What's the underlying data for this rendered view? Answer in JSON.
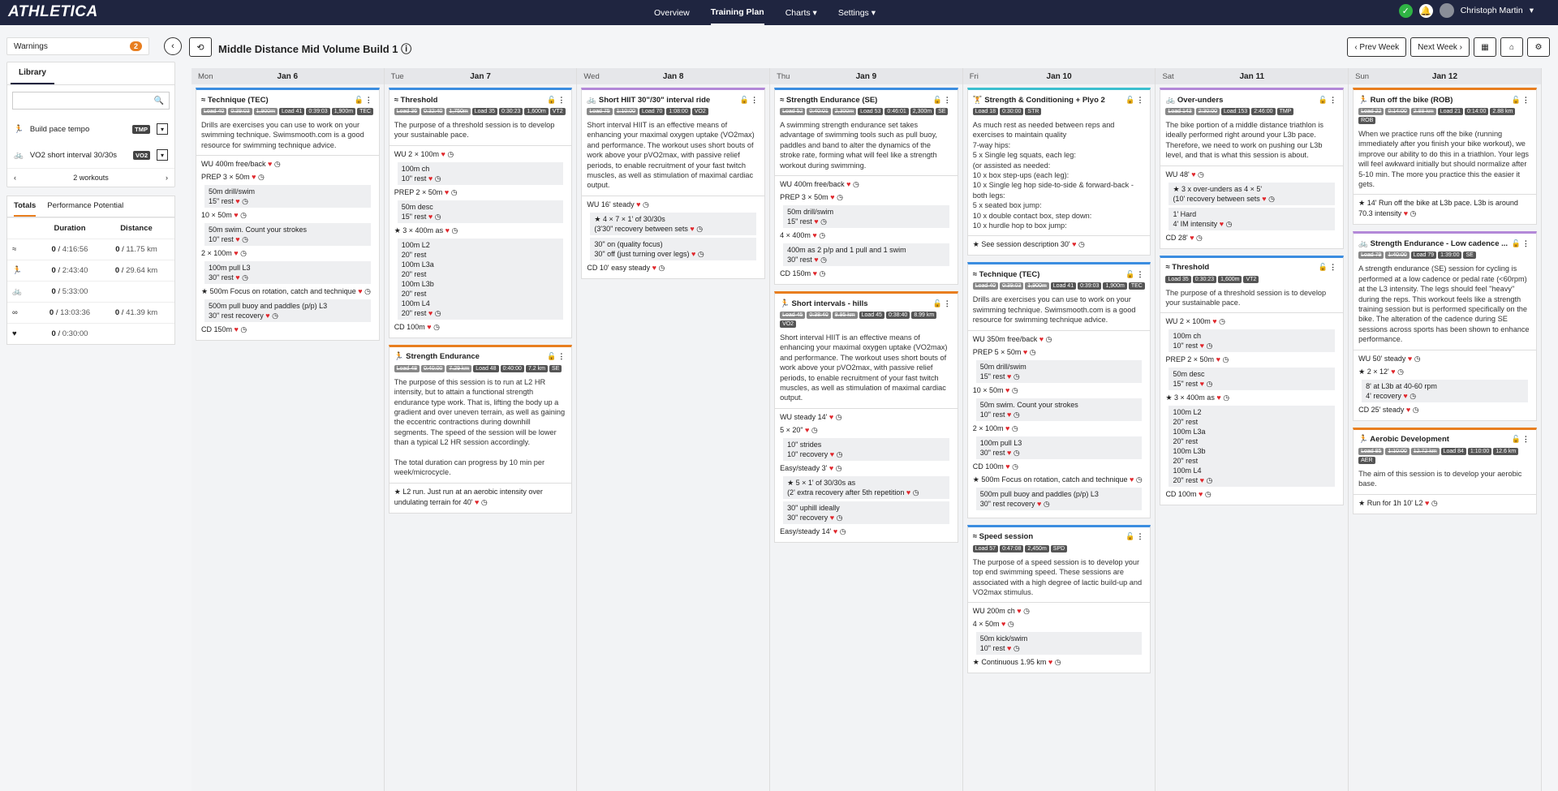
{
  "brand": "ATHLETICA",
  "nav": [
    "Overview",
    "Training Plan",
    "Charts",
    "Settings"
  ],
  "user": "Christoph Martin",
  "notif_count": "0",
  "warnings": {
    "label": "Warnings",
    "count": "2"
  },
  "library": {
    "tab": "Library",
    "items": [
      {
        "name": "Build pace tempo",
        "tag": "TMP"
      },
      {
        "name": "VO2 short interval 30/30s",
        "tag": "VO2"
      }
    ],
    "pager": "2 workouts"
  },
  "totals": {
    "tabs": [
      "Totals",
      "Performance Potential"
    ],
    "headers": [
      "Duration",
      "Distance"
    ],
    "rows": [
      {
        "d1": "0",
        "d2": "4:16:56",
        "k1": "0",
        "k2": "11.75 km"
      },
      {
        "d1": "0",
        "d2": "2:43:40",
        "k1": "0",
        "k2": "29.64 km"
      },
      {
        "d1": "0",
        "d2": "5:33:00",
        "k1": "",
        "k2": ""
      },
      {
        "d1": "0",
        "d2": "13:03:36",
        "k1": "0",
        "k2": "41.39 km"
      },
      {
        "d1": "0",
        "d2": "0:30:00",
        "k1": "",
        "k2": ""
      }
    ]
  },
  "plan": {
    "title": "Middle Distance Mid Volume Build 1",
    "prev": "Prev Week",
    "next": "Next Week"
  },
  "days": [
    {
      "d": "Mon",
      "date": "Jan 6"
    },
    {
      "d": "Tue",
      "date": "Jan 7"
    },
    {
      "d": "Wed",
      "date": "Jan 8"
    },
    {
      "d": "Thu",
      "date": "Jan 9"
    },
    {
      "d": "Fri",
      "date": "Jan 10"
    },
    {
      "d": "Sat",
      "date": "Jan 11"
    },
    {
      "d": "Sun",
      "date": "Jan 12"
    }
  ],
  "cards": {
    "mon1": {
      "title": "Technique (TEC)",
      "desc": "Drills are exercises you can use to work on your swimming technique. Swimsmooth.com is a good resource for swimming technique advice.",
      "lines": [
        "WU 400m free/back",
        "PREP 3 × 50m",
        "50m drill/swim\n15\" rest",
        "10 × 50m",
        "50m swim. Count your strokes\n10\" rest",
        "2 × 100m",
        "100m pull L3\n30\" rest",
        "500m Focus on rotation, catch and technique",
        "500m pull buoy and paddles (p/p) L3\n30\" rest recovery",
        "CD 150m"
      ]
    },
    "tue1": {
      "title": "Threshold",
      "desc": "The purpose of a threshold session is to develop your sustainable pace.",
      "lines": [
        "WU 2 × 100m",
        "100m ch\n10\" rest",
        "PREP 2 × 50m",
        "50m desc\n15\" rest",
        "3 × 400m as",
        "100m L2\n20\" rest\n100m L3a\n20\" rest\n100m L3b\n20\" rest\n100m L4\n20\" rest",
        "CD 100m"
      ]
    },
    "tue2": {
      "title": "Strength Endurance",
      "desc": "The purpose of this session is to run at L2 HR intensity, but to attain a functional strength endurance type work. That is, lifting the body up a gradient and over uneven terrain, as well as gaining the eccentric contractions during downhill segments. The speed of the session will be lower than a typical L2 HR session accordingly.\n\nThe total duration can progress by 10 min per week/microcycle.",
      "lines": [
        "L2 run. Just run at an aerobic intensity over undulating terrain for 40'"
      ]
    },
    "wed1": {
      "title": "Short HIIT 30\"/30\" interval ride",
      "desc": "Short interval HIIT is an effective means of enhancing your maximal oxygen uptake (VO2max) and performance. The workout uses short bouts of work above your pVO2max, with passive relief periods, to enable recruitment of your fast twitch muscles, as well as stimulation of maximal cardiac output.",
      "lines": [
        "WU 16' steady",
        "4 × 7 × 1' of 30/30s\n(3'30\" recovery between sets",
        "30\" on (quality focus)\n30\" off (just turning over legs)",
        "CD 10' easy steady"
      ]
    },
    "thu1": {
      "title": "Strength Endurance (SE)",
      "desc": "A swimming strength endurance set takes advantage of swimming tools such as pull buoy, paddles and band to alter the dynamics of the stroke rate, forming what will feel like a strength workout during swimming.",
      "lines": [
        "WU 400m free/back",
        "PREP 3 × 50m",
        "50m drill/swim\n15\" rest",
        "4 × 400m",
        "400m as 2 p/p and 1 pull and 1 swim\n30\" rest",
        "CD 150m"
      ]
    },
    "thu2": {
      "title": "Short intervals - hills",
      "desc": "Short interval HIIT is an effective means of enhancing your maximal oxygen uptake (VO2max) and performance. The workout uses short bouts of work above your pVO2max, with passive relief periods, to enable recruitment of your fast twitch muscles, as well as stimulation of maximal cardiac output.",
      "lines": [
        "WU steady 14'",
        "5 × 20\"",
        "10\" strides\n10\" recovery",
        "Easy/steady 3'",
        "5 × 1' of 30/30s as\n(2' extra recovery after 5th repetition",
        "30\" uphill ideally\n30\" recovery",
        "Easy/steady 14'"
      ]
    },
    "fri1": {
      "title": "Strength & Conditioning + Plyo 2",
      "desc": "As much rest as needed between reps and exercises to maintain quality\n7-way hips:\n5 x Single leg squats, each leg:\n(or assisted as needed:\n10 x box step-ups (each leg):\n10 x Single leg hop side-to-side & forward-back - both legs:\n5 x seated box jump:\n10 x double contact box, step down:\n10 x hurdle hop to box jump:",
      "lines": [
        "See session description 30'"
      ]
    },
    "fri2": {
      "title": "Technique (TEC)",
      "desc": "Drills are exercises you can use to work on your swimming technique. Swimsmooth.com is a good resource for swimming technique advice.",
      "lines": [
        "WU 350m free/back",
        "PREP 5 × 50m",
        "50m drill/swim\n15\" rest",
        "10 × 50m",
        "50m swim. Count your strokes\n10\" rest",
        "2 × 100m",
        "100m pull L3\n30\" rest",
        "CD 100m",
        "500m Focus on rotation, catch and technique",
        "500m pull buoy and paddles (p/p) L3\n30\" rest recovery"
      ]
    },
    "fri3": {
      "title": "Speed session",
      "desc": "The purpose of a speed session is to develop your top end swimming speed. These sessions are associated with a high degree of lactic build-up and VO2max stimulus.",
      "lines": [
        "WU 200m ch",
        "4 × 50m",
        "50m kick/swim\n10\" rest",
        "Continuous 1.95 km"
      ]
    },
    "sat1": {
      "title": "Over-unders",
      "desc": "The bike portion of a middle distance triathlon is ideally performed right around your L3b pace. Therefore, we need to work on pushing our L3b level, and that is what this session is about.",
      "lines": [
        "WU 48'",
        "3 x over-unders as 4 × 5'\n(10' recovery between sets",
        "1' Hard\n4' IM intensity",
        "CD 28'"
      ]
    },
    "sat2": {
      "title": "Threshold",
      "desc": "The purpose of a threshold session is to develop your sustainable pace.",
      "lines": [
        "WU 2 × 100m",
        "100m ch\n10\" rest",
        "PREP 2 × 50m",
        "50m desc\n15\" rest",
        "3 × 400m as",
        "100m L2\n20\" rest\n100m L3a\n20\" rest\n100m L3b\n20\" rest\n100m L4\n20\" rest",
        "CD 100m"
      ]
    },
    "sun1": {
      "title": "Run off the bike (ROB)",
      "desc": "When we practice runs off the bike (running immediately after you finish your bike workout), we improve our ability to do this in a triathlon. Your legs will feel awkward initially but should normalize after 5-10 min. The more you practice this the easier it gets.",
      "lines": [
        "14' Run off the bike at L3b pace. L3b is around 70.3 intensity"
      ]
    },
    "sun2": {
      "title": "Strength Endurance - Low cadence ...",
      "desc": "A strength endurance (SE) session for cycling is performed at a low cadence or pedal rate (<60rpm) at the L3 intensity. The legs should feel \"heavy\" during the reps. This workout feels like a strength training session but is performed specifically on the bike. The alteration of the cadence during SE sessions across sports has been shown to enhance performance.",
      "lines": [
        "WU 50' steady",
        "2 × 12'",
        "8' at L3b at 40-60 rpm\n4' recovery",
        "CD 25' steady"
      ]
    },
    "sun3": {
      "title": "Aerobic Development",
      "desc": "The aim of this session is to develop your aerobic base.",
      "lines": [
        "Run for 1h 10' L2"
      ]
    }
  },
  "tags": {
    "mon1": [
      [
        "Load 40",
        1
      ],
      [
        "0:39:03",
        1
      ],
      [
        "1,900m",
        1
      ],
      [
        "Load 41",
        0
      ],
      [
        "0:39:03",
        0
      ],
      [
        "1,900m",
        0
      ],
      [
        "TEC",
        0
      ]
    ],
    "tue1": [
      [
        "Load 36",
        1
      ],
      [
        "0:32:40",
        1
      ],
      [
        "1,750m",
        1
      ],
      [
        "Load 35",
        0
      ],
      [
        "0:30:23",
        0
      ],
      [
        "1,600m",
        0
      ],
      [
        "VT2",
        0
      ]
    ],
    "tue2": [
      [
        "Load 48",
        1
      ],
      [
        "0:40:00",
        1
      ],
      [
        "7.29 km",
        1
      ],
      [
        "Load 48",
        0
      ],
      [
        "0:40:00",
        0
      ],
      [
        "7.2 km",
        0
      ],
      [
        "SE",
        0
      ]
    ],
    "wed1": [
      [
        "Load 75",
        1
      ],
      [
        "1:10:00",
        1
      ],
      [
        "Load 70",
        0
      ],
      [
        "1:08:00",
        0
      ],
      [
        "VO2",
        0
      ]
    ],
    "thu1": [
      [
        "Load 52",
        1
      ],
      [
        "0:40:01",
        1
      ],
      [
        "2,300m",
        1
      ],
      [
        "Load 53",
        0
      ],
      [
        "0:46:01",
        0
      ],
      [
        "2,300m",
        0
      ],
      [
        "SE",
        0
      ]
    ],
    "thu2": [
      [
        "Load 45",
        1
      ],
      [
        "0:38:40",
        1
      ],
      [
        "8.95 km",
        1
      ],
      [
        "Load 45",
        0
      ],
      [
        "0:38:40",
        0
      ],
      [
        "8.99 km",
        0
      ],
      [
        "VO2",
        0
      ]
    ],
    "fri1": [
      [
        "Load 18",
        0
      ],
      [
        "0:30:00",
        0
      ],
      [
        "STR",
        0
      ]
    ],
    "fri2": [
      [
        "Load 40",
        1
      ],
      [
        "0:39:03",
        1
      ],
      [
        "1,900m",
        1
      ],
      [
        "Load 41",
        0
      ],
      [
        "0:39:03",
        0
      ],
      [
        "1,900m",
        0
      ],
      [
        "TEC",
        0
      ]
    ],
    "fri3": [
      [
        "Load 57",
        0
      ],
      [
        "0:47:08",
        0
      ],
      [
        "2,450m",
        0
      ],
      [
        "SPD",
        0
      ]
    ],
    "sat1": [
      [
        "Load 143",
        1
      ],
      [
        "2:30:00",
        1
      ],
      [
        "Load 153",
        0
      ],
      [
        "2:46:00",
        0
      ],
      [
        "TMP",
        0
      ]
    ],
    "sat2": [
      [
        "Load 35",
        0
      ],
      [
        "0:30:23",
        0
      ],
      [
        "1,600m",
        0
      ],
      [
        "VT2",
        0
      ]
    ],
    "sun1": [
      [
        "Load 22",
        1
      ],
      [
        "0:14:00",
        1
      ],
      [
        "2.88 km",
        1
      ],
      [
        "Load 21",
        0
      ],
      [
        "0:14:00",
        0
      ],
      [
        "2.88 km",
        0
      ],
      [
        "ROB",
        0
      ]
    ],
    "sun2": [
      [
        "Load 79",
        1
      ],
      [
        "1:40:00",
        1
      ],
      [
        "Load 79",
        0
      ],
      [
        "1:39:00",
        0
      ],
      [
        "SE",
        0
      ]
    ],
    "sun3": [
      [
        "Load 85",
        1
      ],
      [
        "1:10:00",
        1
      ],
      [
        "12.72 km",
        1
      ],
      [
        "Load 84",
        0
      ],
      [
        "1:10:00",
        0
      ],
      [
        "12.6 km",
        0
      ],
      [
        "AER",
        0
      ]
    ]
  }
}
